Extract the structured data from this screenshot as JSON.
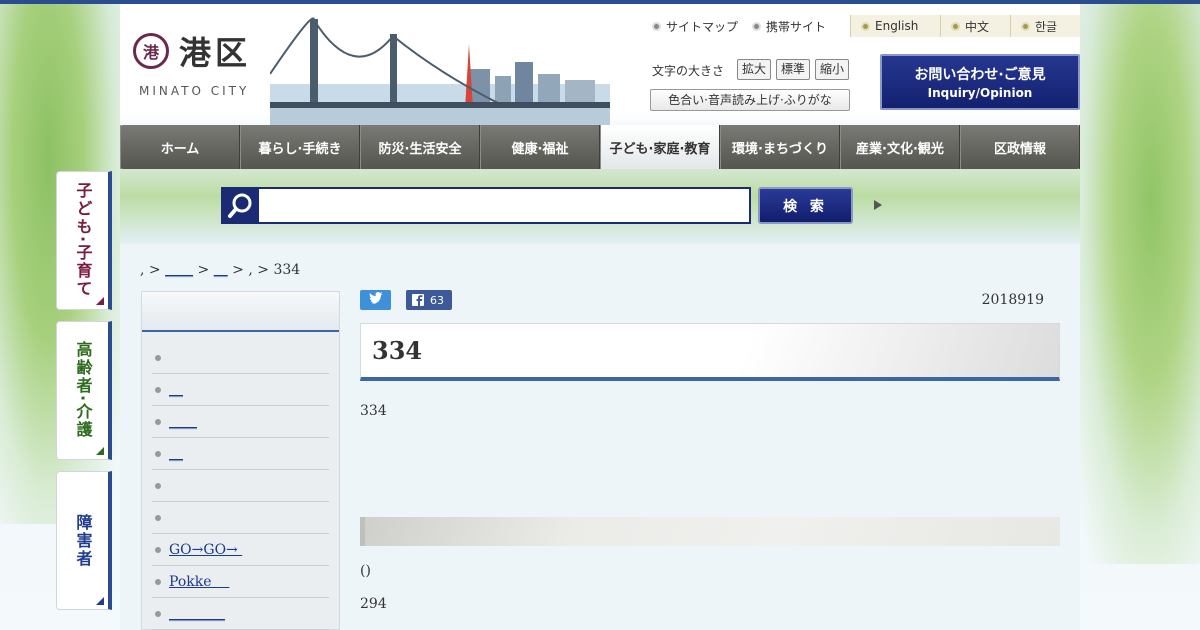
{
  "header": {
    "logo_mark": "港",
    "logo_text": "港区",
    "logo_en": "MINATO CITY",
    "utility_links": [
      "サイトマップ",
      "携帯サイト"
    ],
    "languages": [
      "English",
      "中文",
      "한글"
    ],
    "font_size_label": "文字の大きさ",
    "font_size_buttons": [
      "拡大",
      "標準",
      "縮小"
    ],
    "accessibility_button": "色合い·音声読み上げ·ふりがな",
    "inquiry_jp": "お問い合わせ·ご意見",
    "inquiry_en": "Inquiry/Opinion"
  },
  "nav": {
    "items": [
      "ホーム",
      "暮らし·手続き",
      "防災·生活安全",
      "健康·福祉",
      "子ども·家庭·教育",
      "環境·まちづくり",
      "産業·文化·観光",
      "区政情報"
    ],
    "active_index": 4
  },
  "search": {
    "input_value": "",
    "button_label": "検 索"
  },
  "side_tabs": [
    {
      "label": "子ども·子育て",
      "color": "#7a1b3f"
    },
    {
      "label": "高齢者·介護",
      "color": "#2e6b1e"
    },
    {
      "label": "障害者",
      "color": "#1f3c8f"
    }
  ],
  "breadcrumb": {
    "sep1": ", > ",
    "link1": "____",
    "sep2": " > ",
    "link2": "__",
    "sep3": " > , > ",
    "current": "334"
  },
  "left_menu": {
    "items": [
      {
        "label": "",
        "link": false
      },
      {
        "label": "__",
        "link": true
      },
      {
        "label": "____",
        "link": true
      },
      {
        "label": "__",
        "link": true
      },
      {
        "label": "",
        "link": false
      },
      {
        "label": "",
        "link": false
      },
      {
        "label": "GO→GO→ ",
        "link": true
      },
      {
        "label": "Pokke    ",
        "link": true
      },
      {
        "label": "________",
        "link": true
      }
    ]
  },
  "content": {
    "fb_count": "63",
    "date": "2018919",
    "title": "334",
    "body1": "334",
    "body2": "()",
    "body3": "294"
  }
}
